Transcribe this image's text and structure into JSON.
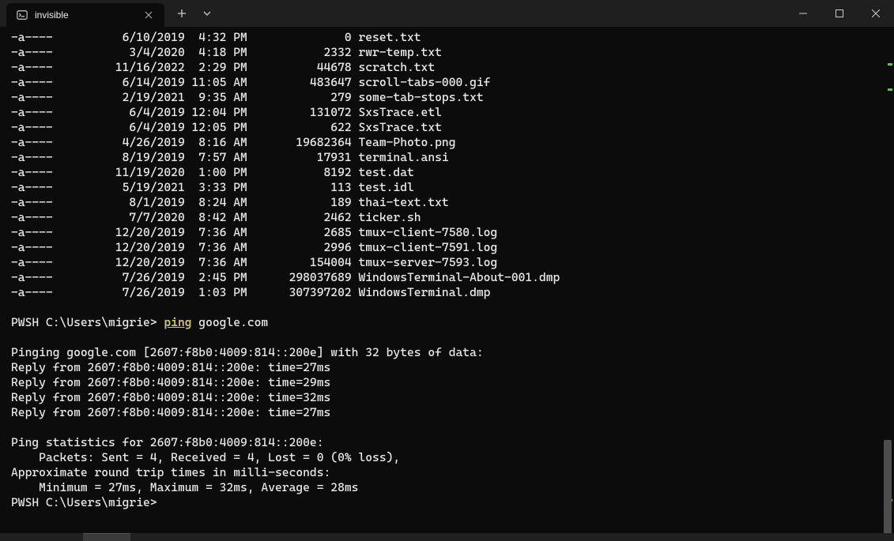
{
  "tab": {
    "title": "invisible"
  },
  "listing": [
    {
      "mode": "-a----",
      "date": "6/10/2019",
      "time": "4:32 PM",
      "size": "0",
      "name": "reset.txt"
    },
    {
      "mode": "-a----",
      "date": "3/4/2020",
      "time": "4:18 PM",
      "size": "2332",
      "name": "rwr-temp.txt"
    },
    {
      "mode": "-a----",
      "date": "11/16/2022",
      "time": "2:29 PM",
      "size": "44678",
      "name": "scratch.txt"
    },
    {
      "mode": "-a----",
      "date": "6/14/2019",
      "time": "11:05 AM",
      "size": "483647",
      "name": "scroll-tabs-000.gif"
    },
    {
      "mode": "-a----",
      "date": "2/19/2021",
      "time": "9:35 AM",
      "size": "279",
      "name": "some-tab-stops.txt"
    },
    {
      "mode": "-a----",
      "date": "6/4/2019",
      "time": "12:04 PM",
      "size": "131072",
      "name": "SxsTrace.etl"
    },
    {
      "mode": "-a----",
      "date": "6/4/2019",
      "time": "12:05 PM",
      "size": "622",
      "name": "SxsTrace.txt"
    },
    {
      "mode": "-a----",
      "date": "4/26/2019",
      "time": "8:16 AM",
      "size": "19682364",
      "name": "Team-Photo.png"
    },
    {
      "mode": "-a----",
      "date": "8/19/2019",
      "time": "7:57 AM",
      "size": "17931",
      "name": "terminal.ansi"
    },
    {
      "mode": "-a----",
      "date": "11/19/2020",
      "time": "1:00 PM",
      "size": "8192",
      "name": "test.dat"
    },
    {
      "mode": "-a----",
      "date": "5/19/2021",
      "time": "3:33 PM",
      "size": "113",
      "name": "test.idl"
    },
    {
      "mode": "-a----",
      "date": "8/1/2019",
      "time": "8:24 AM",
      "size": "189",
      "name": "thai-text.txt"
    },
    {
      "mode": "-a----",
      "date": "7/7/2020",
      "time": "8:42 AM",
      "size": "2462",
      "name": "ticker.sh"
    },
    {
      "mode": "-a----",
      "date": "12/20/2019",
      "time": "7:36 AM",
      "size": "2685",
      "name": "tmux-client-7580.log"
    },
    {
      "mode": "-a----",
      "date": "12/20/2019",
      "time": "7:36 AM",
      "size": "2996",
      "name": "tmux-client-7591.log"
    },
    {
      "mode": "-a----",
      "date": "12/20/2019",
      "time": "7:36 AM",
      "size": "154004",
      "name": "tmux-server-7593.log"
    },
    {
      "mode": "-a----",
      "date": "7/26/2019",
      "time": "2:45 PM",
      "size": "298037689",
      "name": "WindowsTerminal-About-001.dmp"
    },
    {
      "mode": "-a----",
      "date": "7/26/2019",
      "time": "1:03 PM",
      "size": "307397202",
      "name": "WindowsTerminal.dmp"
    }
  ],
  "prompt1": {
    "prefix": "PWSH C:\\Users\\migrie> ",
    "cmd": "ping",
    "args": " google.com"
  },
  "ping": {
    "header": "Pinging google.com [2607:f8b0:4009:814::200e] with 32 bytes of data:",
    "replies": [
      "Reply from 2607:f8b0:4009:814::200e: time=27ms",
      "Reply from 2607:f8b0:4009:814::200e: time=29ms",
      "Reply from 2607:f8b0:4009:814::200e: time=32ms",
      "Reply from 2607:f8b0:4009:814::200e: time=27ms"
    ],
    "stats_header": "Ping statistics for 2607:f8b0:4009:814::200e:",
    "packets": "    Packets: Sent = 4, Received = 4, Lost = 0 (0% loss),",
    "rtt_header": "Approximate round trip times in milli-seconds:",
    "rtt": "    Minimum = 27ms, Maximum = 32ms, Average = 28ms"
  },
  "prompt2": "PWSH C:\\Users\\migrie>"
}
